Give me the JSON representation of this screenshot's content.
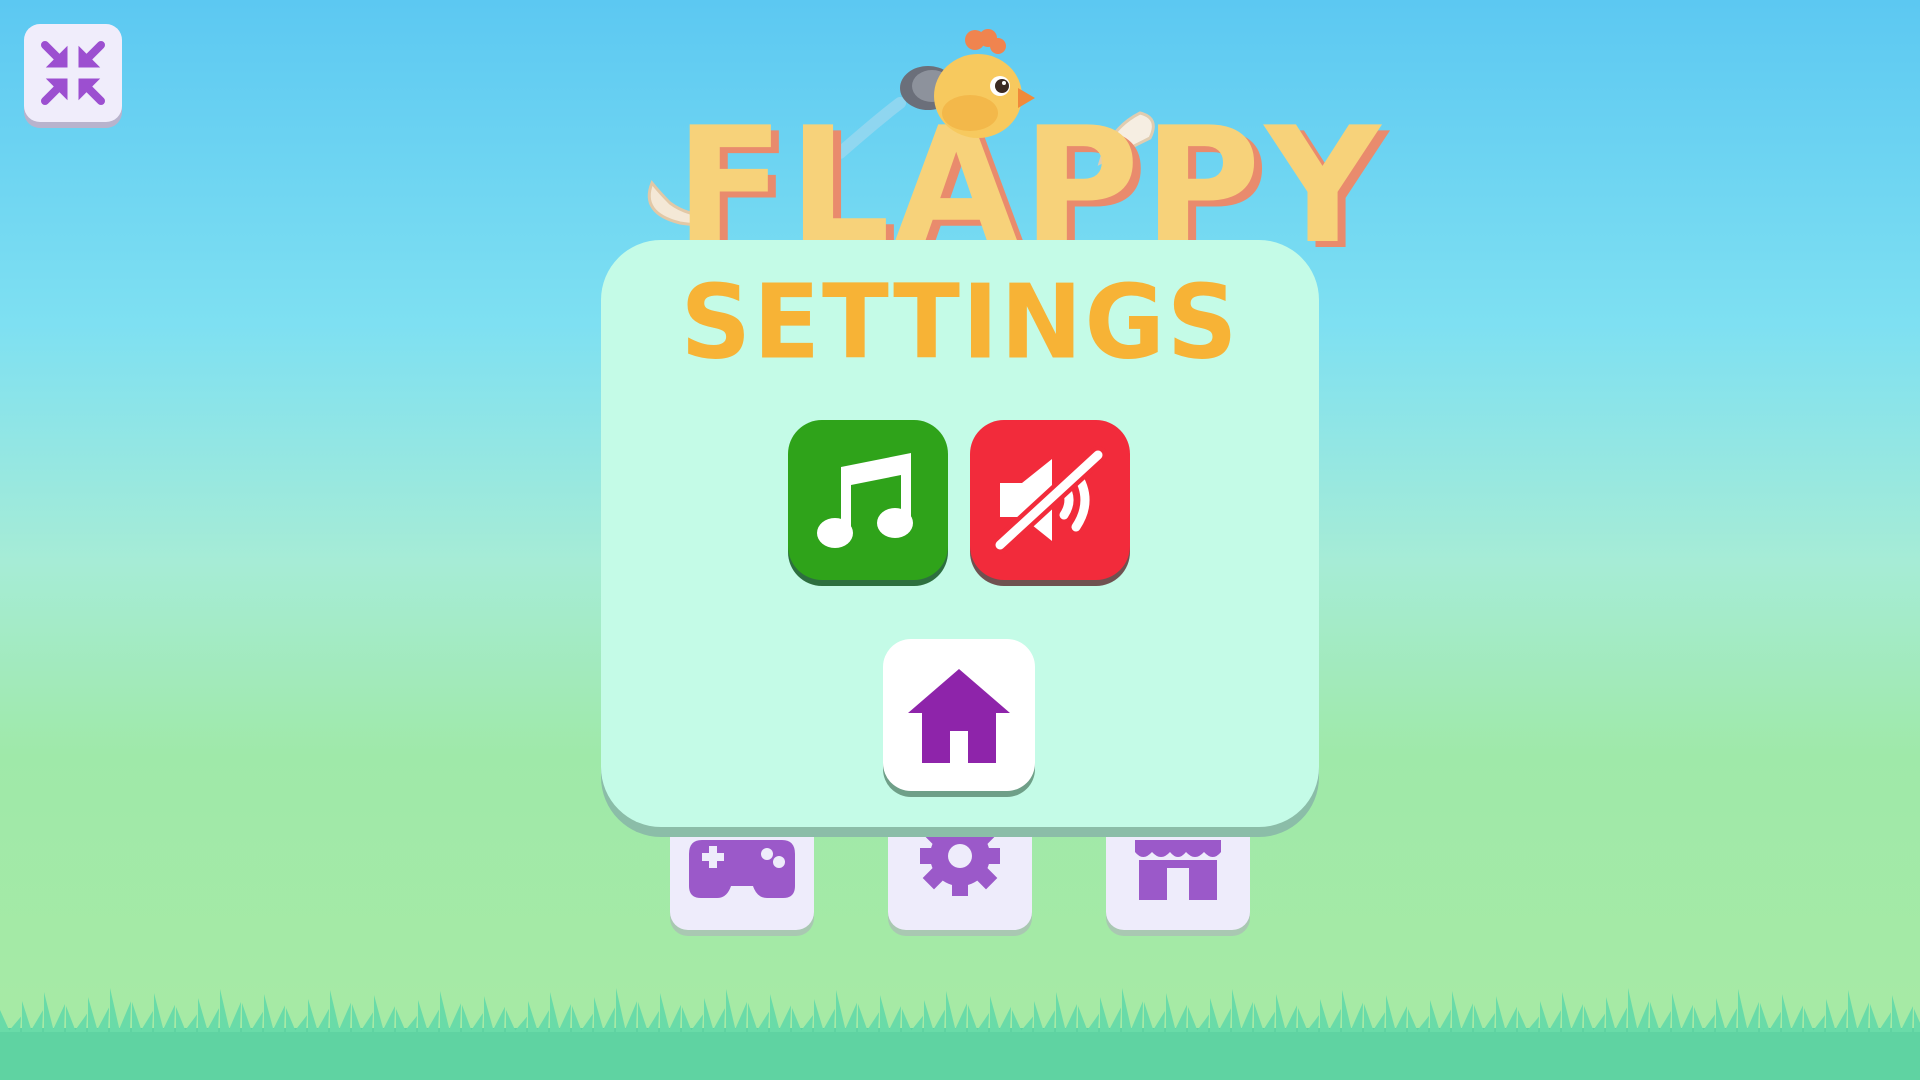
{
  "game": {
    "logo_text": "FLAPPY",
    "logo_character": "chick-icon"
  },
  "top_left": {
    "fullscreen_icon": "exit-fullscreen-icon"
  },
  "settings_panel": {
    "title": "SETTINGS",
    "music_toggle": {
      "icon": "music-note-icon",
      "state": "on",
      "color": "#2fa31a"
    },
    "sound_toggle": {
      "icon": "sound-muted-icon",
      "state": "off",
      "color": "#f22b3b"
    },
    "home_button": {
      "icon": "home-icon"
    }
  },
  "menu": {
    "buttons": [
      {
        "icon": "gamepad-icon"
      },
      {
        "icon": "gear-icon"
      },
      {
        "icon": "shop-icon"
      }
    ]
  },
  "colors": {
    "accent_purple": "#8e24aa",
    "title_orange": "#f7b336",
    "panel_bg": "#c4fbe7"
  }
}
